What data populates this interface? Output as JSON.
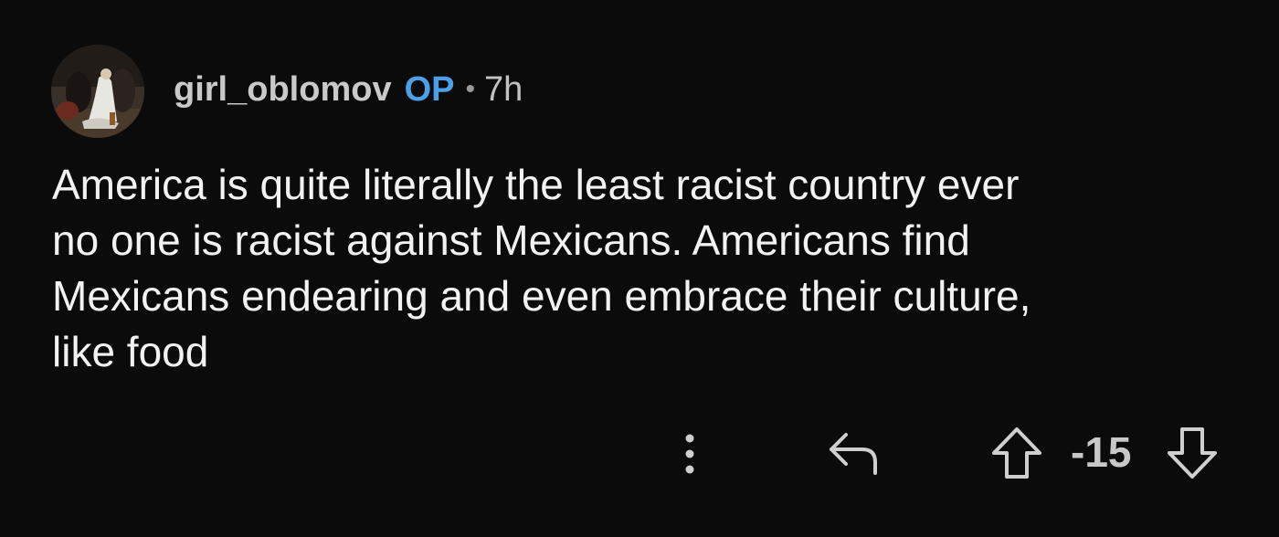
{
  "comment": {
    "author": "girl_oblomov",
    "op_badge": "OP",
    "separator": "•",
    "time": "7h",
    "avatar_icon": "painting-avatar",
    "text": "America is quite literally the least racist country ever\nno one is racist against Mexicans. Americans find\nMexicans endearing and even embrace their culture,\nlike food",
    "score": "-15"
  },
  "actions": {
    "more_icon": "vertical-ellipsis-icon",
    "reply_icon": "reply-arrow-icon",
    "upvote_icon": "upvote-arrow-icon",
    "downvote_icon": "downvote-arrow-icon"
  },
  "colors": {
    "background": "#0b0b0c",
    "op_badge": "#4d9fe8",
    "text": "#f2f2f2",
    "muted": "#c2c2c2"
  }
}
